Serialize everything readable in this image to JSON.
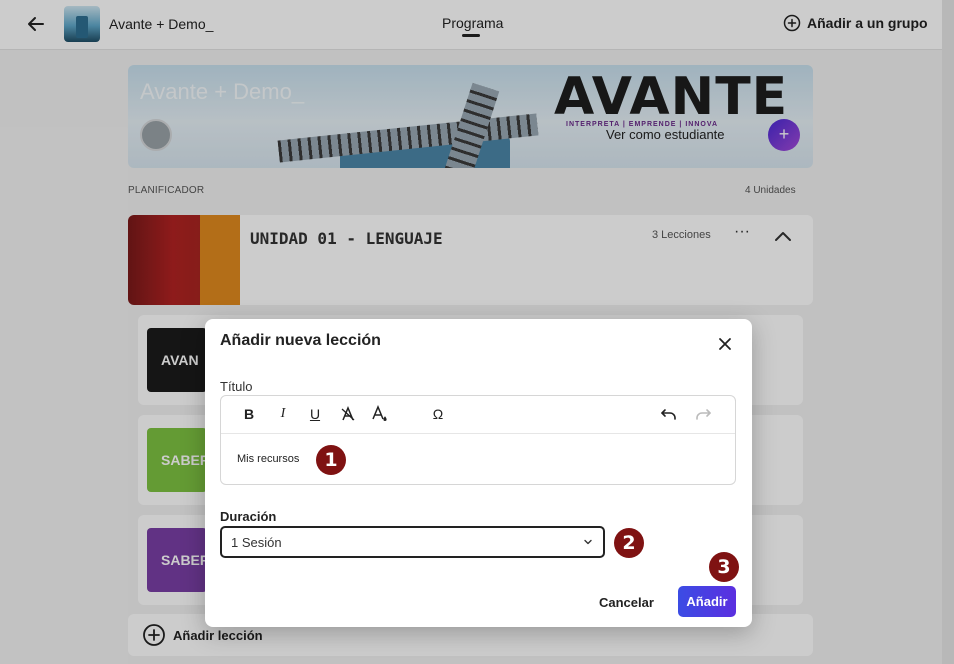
{
  "topbar": {
    "course_name": "Avante + Demo_",
    "tab_label": "Programa",
    "add_group_label": "Añadir a un grupo"
  },
  "banner": {
    "title": "Avante + Demo_",
    "logo_text": "AVANTE",
    "tagline": "INTERPRETA | EMPRENDE | INNOVA",
    "see_as_student": "Ver como estudiante",
    "plus": "+"
  },
  "planner": {
    "label": "PLANIFICADOR",
    "units_count": "4 Unidades"
  },
  "unit": {
    "title": "UNIDAD 01 - LENGUAJE",
    "lessons_count": "3 Lecciones",
    "more": "···"
  },
  "lessons": [
    {
      "thumb_text": "AVAN"
    },
    {
      "thumb_text": "SABER"
    },
    {
      "thumb_text": "SABER"
    }
  ],
  "add_lesson_label": "Añadir lección",
  "modal": {
    "title": "Añadir nueva lección",
    "title_field_label": "Título",
    "toolbar": {
      "bold": "B",
      "italic": "I",
      "underline": "U",
      "clear_format": "A",
      "text_color": "A",
      "special_char": "Ω"
    },
    "editor_content": "Mis recursos",
    "duration_label": "Duración",
    "duration_value": "1 Sesión",
    "cancel_label": "Cancelar",
    "add_label": "Añadir"
  },
  "markers": [
    "1",
    "2",
    "3"
  ],
  "colors": {
    "accent_start": "#3b4ce4",
    "accent_end": "#5b2fe0",
    "marker": "#7f1212"
  }
}
